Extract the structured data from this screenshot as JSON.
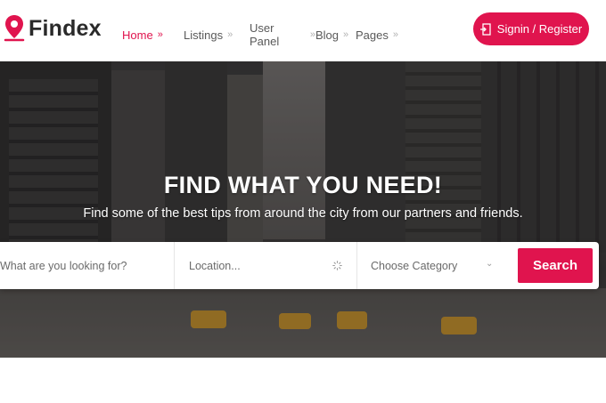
{
  "brand": {
    "name": "Findex",
    "accent": "#e0144e"
  },
  "nav": {
    "items": [
      {
        "label": "Home",
        "chevron": "»"
      },
      {
        "label": "Listings",
        "chevron": "»"
      },
      {
        "label": "User Panel",
        "chevron": "»"
      },
      {
        "label": "Blog",
        "chevron": "»"
      },
      {
        "label": "Pages",
        "chevron": "»"
      }
    ],
    "active_index": 0
  },
  "signin": {
    "label": "Signin / Register",
    "icon": "login-icon"
  },
  "hero": {
    "title": "FIND WHAT YOU NEED!",
    "subtitle": "Find some of the best tips from around the city from our partners and friends."
  },
  "search": {
    "what_placeholder": "What are you looking for?",
    "location_placeholder": "Location...",
    "location_icon": "spinner-icon",
    "category_selected": "Choose Category",
    "category_icon": "chevron-down-icon",
    "button_label": "Search"
  }
}
